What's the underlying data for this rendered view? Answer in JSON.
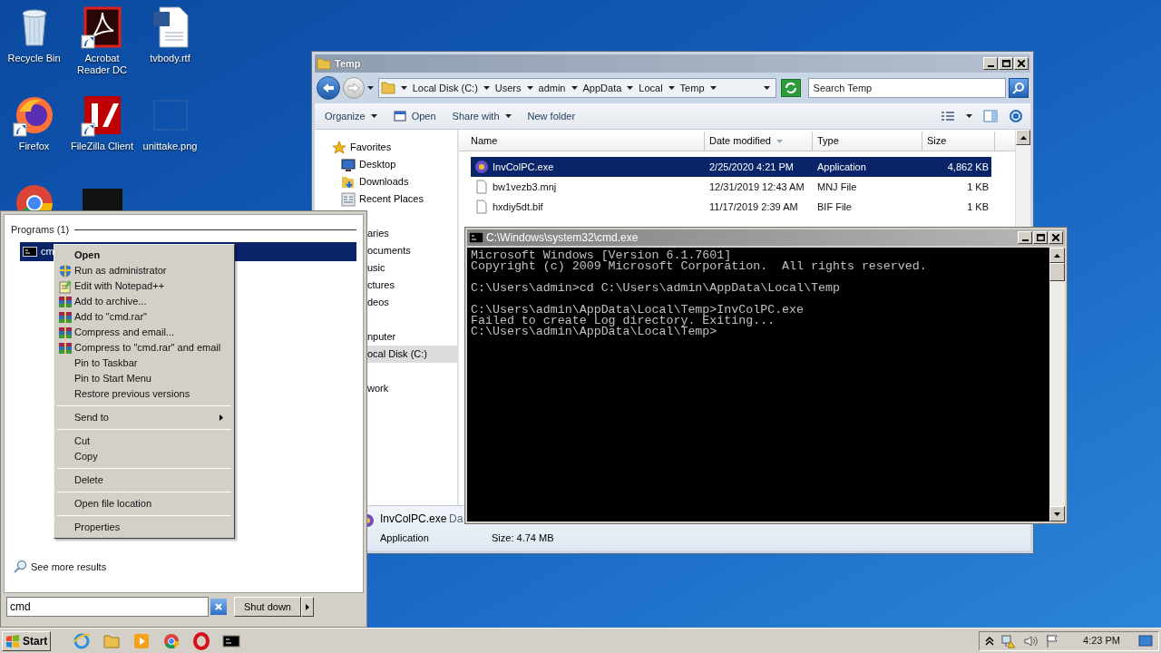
{
  "desktop_icons": [
    {
      "label": "Recycle Bin",
      "kind": "recycle",
      "shortcut": false
    },
    {
      "label": "Acrobat Reader DC",
      "kind": "acrobat",
      "shortcut": true
    },
    {
      "label": "tvbody.rtf",
      "kind": "word",
      "shortcut": false
    },
    {
      "label": "Firefox",
      "kind": "firefox",
      "shortcut": true
    },
    {
      "label": "FileZilla Client",
      "kind": "filezilla",
      "shortcut": true
    },
    {
      "label": "unittake.png",
      "kind": "image",
      "shortcut": false
    },
    {
      "kind": "chrome"
    },
    {
      "kind": "dark"
    }
  ],
  "explorer": {
    "title": "Temp",
    "breadcrumb": [
      "Local Disk (C:)",
      "Users",
      "admin",
      "AppData",
      "Local",
      "Temp"
    ],
    "search": {
      "placeholder": "Search Temp"
    },
    "toolbar": [
      {
        "label": "Organize",
        "kind": "menu"
      },
      {
        "label": "Open",
        "kind": "open"
      },
      {
        "label": "Share with",
        "kind": "menu"
      },
      {
        "label": "New folder",
        "kind": "plain"
      }
    ],
    "nav_pane": [
      [
        {
          "label": "Favorites",
          "kind": "star",
          "selected": false
        },
        {
          "label": "Desktop",
          "kind": "desktop",
          "selected": false
        },
        {
          "label": "Downloads",
          "kind": "downloads",
          "selected": false
        },
        {
          "label": "Recent Places",
          "kind": "recent",
          "selected": false
        }
      ],
      [
        {
          "label": "aries",
          "kind": "covered",
          "selected": false
        },
        {
          "label": "ocuments",
          "kind": "covered",
          "selected": false
        },
        {
          "label": "usic",
          "kind": "covered",
          "selected": false
        },
        {
          "label": "ctures",
          "kind": "covered",
          "selected": false
        },
        {
          "label": "deos",
          "kind": "covered",
          "selected": false
        }
      ],
      [
        {
          "label": "nputer",
          "kind": "covered",
          "selected": false
        },
        {
          "label": "ocal Disk (C:)",
          "kind": "covered",
          "selected": true
        }
      ],
      [
        {
          "label": "work",
          "kind": "covered",
          "selected": false
        }
      ]
    ],
    "columns": [
      {
        "label": "Name",
        "sorted": false
      },
      {
        "label": "Date modified",
        "sorted": true
      },
      {
        "label": "Type",
        "sorted": false
      },
      {
        "label": "Size",
        "sorted": false
      }
    ],
    "files": [
      {
        "name": "InvColPC.exe",
        "date": "2/25/2020 4:21 PM",
        "type": "Application",
        "size": "4,862 KB",
        "kind": "app",
        "selected": true
      },
      {
        "name": "bw1vezb3.mnj",
        "date": "12/31/2019 12:43 AM",
        "type": "MNJ File",
        "size": "1 KB",
        "kind": "file",
        "selected": false
      },
      {
        "name": "hxdiy5dt.bif",
        "date": "11/17/2019 2:39 AM",
        "type": "BIF File",
        "size": "1 KB",
        "kind": "file",
        "selected": false
      }
    ],
    "details": {
      "name": "InvColPC.exe",
      "label": "Da",
      "type": "Application",
      "size": "Size: 4.74 MB"
    }
  },
  "cmd_window": {
    "title": "C:\\Windows\\system32\\cmd.exe",
    "blocks": [
      [
        "Microsoft Windows [Version 6.1.7601]",
        "Copyright (c) 2009 Microsoft Corporation.  All rights reserved."
      ],
      [
        "C:\\Users\\admin>cd C:\\Users\\admin\\AppData\\Local\\Temp"
      ],
      [
        "C:\\Users\\admin\\AppData\\Local\\Temp>InvColPC.exe",
        "Failed to create Log directory. Exiting...",
        "C:\\Users\\admin\\AppData\\Local\\Temp>"
      ]
    ]
  },
  "start_menu": {
    "heading": "Programs (1)",
    "results": [
      {
        "label": "cm",
        "selected": true
      }
    ],
    "see_more": "See more results",
    "search": {
      "value": "cmd"
    },
    "shutdown": "Shut down"
  },
  "context_menu": {
    "groups": [
      [
        {
          "label": "Open",
          "kind": "plain",
          "default": true,
          "submenu": false
        },
        {
          "label": "Run as administrator",
          "kind": "shield",
          "default": false,
          "submenu": false
        },
        {
          "label": "Edit with Notepad++",
          "kind": "notepad",
          "default": false,
          "submenu": false
        },
        {
          "label": "Add to archive...",
          "kind": "rar",
          "default": false,
          "submenu": false
        },
        {
          "label": "Add to \"cmd.rar\"",
          "kind": "rar",
          "default": false,
          "submenu": false
        },
        {
          "label": "Compress and email...",
          "kind": "rar",
          "default": false,
          "submenu": false
        },
        {
          "label": "Compress to \"cmd.rar\" and email",
          "kind": "rar",
          "default": false,
          "submenu": false
        },
        {
          "label": "Pin to Taskbar",
          "kind": "plain",
          "default": false,
          "submenu": false
        },
        {
          "label": "Pin to Start Menu",
          "kind": "plain",
          "default": false,
          "submenu": false
        },
        {
          "label": "Restore previous versions",
          "kind": "plain",
          "default": false,
          "submenu": false
        }
      ],
      [
        {
          "label": "Send to",
          "kind": "plain",
          "default": false,
          "submenu": true
        }
      ],
      [
        {
          "label": "Cut",
          "kind": "plain",
          "default": false,
          "submenu": false
        },
        {
          "label": "Copy",
          "kind": "plain",
          "default": false,
          "submenu": false
        }
      ],
      [
        {
          "label": "Delete",
          "kind": "plain",
          "default": false,
          "submenu": false
        }
      ],
      [
        {
          "label": "Open file location",
          "kind": "plain",
          "default": false,
          "submenu": false
        }
      ],
      [
        {
          "label": "Properties",
          "kind": "plain",
          "default": false,
          "submenu": false
        }
      ]
    ]
  },
  "taskbar": {
    "start": "Start",
    "apps": [
      {
        "kind": "ie"
      },
      {
        "kind": "explorer"
      },
      {
        "kind": "media"
      },
      {
        "kind": "chrome"
      },
      {
        "kind": "opera"
      },
      {
        "kind": "cmd"
      }
    ],
    "clock": "4:23 PM"
  }
}
